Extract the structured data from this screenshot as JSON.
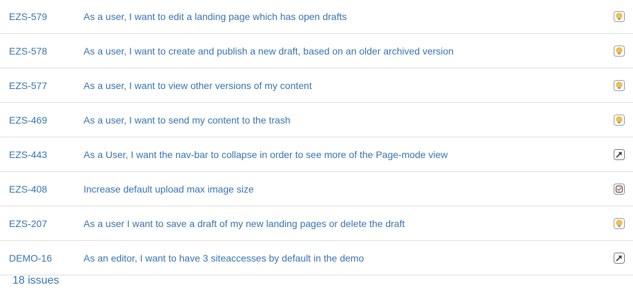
{
  "issues": [
    {
      "key": "EZS-579",
      "summary": "As a user, I want to edit a landing page which has open drafts",
      "type_icon": "story-icon"
    },
    {
      "key": "EZS-578",
      "summary": "As a user, I want to create and publish a new draft, based on an older archived version",
      "type_icon": "story-icon"
    },
    {
      "key": "EZS-577",
      "summary": "As a user, I want to view other versions of my content",
      "type_icon": "story-icon"
    },
    {
      "key": "EZS-469",
      "summary": "As a user, I want to send my content to the trash",
      "type_icon": "story-icon"
    },
    {
      "key": "EZS-443",
      "summary": "As a User, I want the nav-bar to collapse in order to see more of the Page-mode view",
      "type_icon": "improvement-icon"
    },
    {
      "key": "EZS-408",
      "summary": "Increase default upload max image size",
      "type_icon": "task-icon"
    },
    {
      "key": "EZS-207",
      "summary": "As a user I want to save a draft of my new landing pages or delete the draft",
      "type_icon": "story-icon"
    },
    {
      "key": "DEMO-16",
      "summary": "As an editor, I want to have 3 siteaccesses by default in the demo",
      "type_icon": "improvement-icon"
    }
  ],
  "footer": {
    "count_label": "18 issues"
  },
  "colors": {
    "link": "#3572b0",
    "divider": "#dddddd",
    "story": "#f6c342",
    "improvement": "#3b3b3b",
    "task": "#4a4a4a"
  }
}
